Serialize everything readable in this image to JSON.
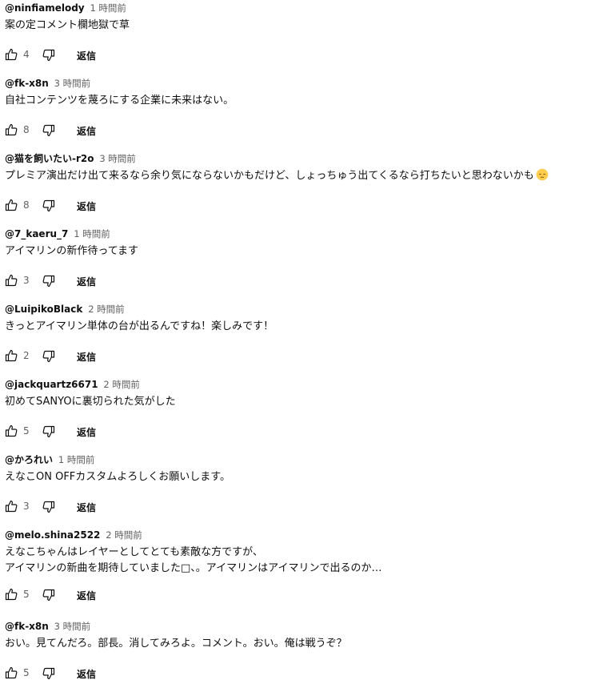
{
  "comments": [
    {
      "author": "@ninfiamelody",
      "time": "1 時間前",
      "text": "案の定コメント欄地獄で草",
      "likes": "4",
      "reply": "返信"
    },
    {
      "author": "@fk-x8n",
      "time": "3 時間前",
      "text": "自社コンテンツを蔑ろにする企業に未来はない。",
      "likes": "8",
      "reply": "返信"
    },
    {
      "author": "@猫を飼いたい-r2o",
      "time": "3 時間前",
      "text": "プレミア演出だけ出て来るなら余り気にならないかもだけど、しょっちゅう出てくるなら打ちたいと思わないかも",
      "emoji": "pensive-face",
      "likes": "8",
      "reply": "返信"
    },
    {
      "author": "@7_kaeru_7",
      "time": "1 時間前",
      "text": "アイマリンの新作待ってます",
      "likes": "3",
      "reply": "返信"
    },
    {
      "author": "@LuipikoBlack",
      "time": "2 時間前",
      "text": "きっとアイマリン単体の台が出るんですね！楽しみです！",
      "likes": "2",
      "reply": "返信"
    },
    {
      "author": "@jackquartz6671",
      "time": "2 時間前",
      "text": "初めてSANYOに裏切られた気がした",
      "likes": "5",
      "reply": "返信"
    },
    {
      "author": "@かろれい",
      "time": "1 時間前",
      "text": "えなこON OFFカスタムよろしくお願いします。",
      "likes": "3",
      "reply": "返信"
    },
    {
      "author": "@melo.shina2522",
      "time": "2 時間前",
      "text": "えなこちゃんはレイヤーとしてとても素敵な方ですが、\nアイマリンの新曲を期待していました□、。アイマリンはアイマリンで出るのか…",
      "likes": "5",
      "reply": "返信"
    },
    {
      "author": "@fk-x8n",
      "time": "3 時間前",
      "text": "おい。見てんだろ。部長。消してみろよ。コメント。おい。俺は戦うぞ？",
      "likes": "5",
      "reply": "返信"
    }
  ]
}
